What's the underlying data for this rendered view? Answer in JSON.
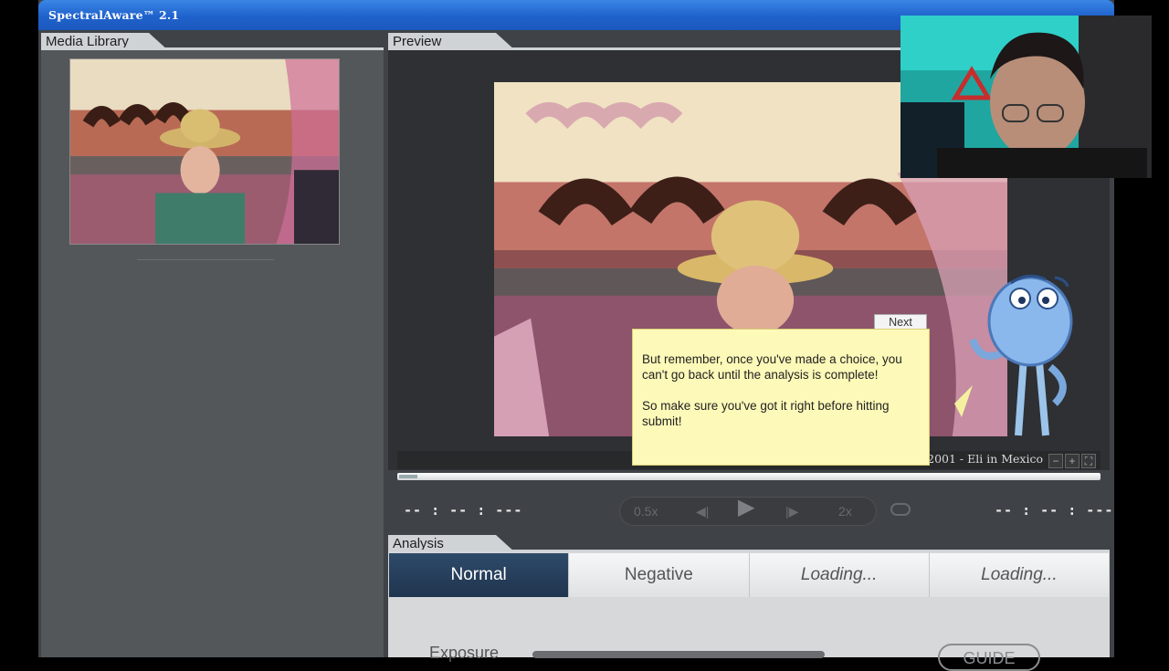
{
  "window": {
    "title": "SpectralAware™ 2.1"
  },
  "library": {
    "title": "Media Library"
  },
  "preview": {
    "title": "Preview",
    "caption": "2001 - Eli in Mexico",
    "zoom_buttons": [
      "−",
      "+",
      "⛶"
    ]
  },
  "playback": {
    "time_start": "-- : -- : ---",
    "time_end": "-- : -- : ---",
    "slow": "0.5x",
    "fast": "2x"
  },
  "tooltip": {
    "next": "Next",
    "line1": "But remember, once you've made a choice, you can't go back until the analysis is complete!",
    "line2": "So make sure you've got it right before hitting submit!"
  },
  "analysis": {
    "title": "Analysis",
    "tabs": [
      "Normal",
      "Negative",
      "Loading...",
      "Loading..."
    ],
    "exposure_label": "Exposure",
    "guide_label": "GUIDE"
  },
  "colors": {
    "titlebar": "#1f62cc",
    "active_tab": "#2e4a6a",
    "tooltip": "#fdf9b8"
  }
}
